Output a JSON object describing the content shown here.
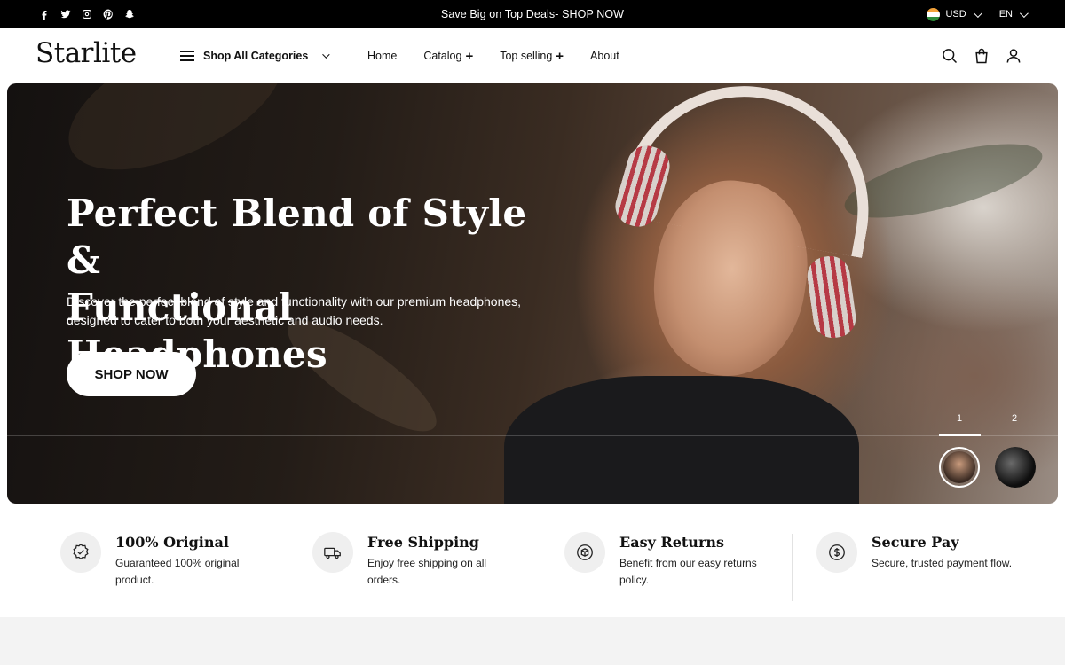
{
  "topbar": {
    "social_icons": [
      "facebook-icon",
      "twitter-icon",
      "instagram-icon",
      "pinterest-icon",
      "snapchat-icon"
    ],
    "announcement": "Save Big on Top Deals- SHOP NOW",
    "currency": "USD",
    "language": "EN"
  },
  "header": {
    "logo": "Starlite",
    "categories_label": "Shop All Categories",
    "nav": [
      {
        "label": "Home",
        "plus": ""
      },
      {
        "label": "Catalog",
        "plus": "+"
      },
      {
        "label": "Top selling",
        "plus": "+"
      },
      {
        "label": "About",
        "plus": ""
      }
    ],
    "icons": [
      "search-icon",
      "cart-bag-icon",
      "account-icon"
    ]
  },
  "hero": {
    "title_line1": "Perfect Blend of Style &",
    "title_line2": "Functional Headphones",
    "description": "Discover the perfect blend of style and functionality with our premium headphones, designed to cater to both your aesthetic and audio needs.",
    "cta": "SHOP NOW",
    "slides": [
      "1",
      "2"
    ],
    "active_slide": 1
  },
  "features": [
    {
      "title": "100% Original",
      "text": "Guaranteed 100% original product.",
      "icon": "badge-check-icon"
    },
    {
      "title": "Free Shipping",
      "text": "Enjoy free shipping on all orders.",
      "icon": "truck-icon"
    },
    {
      "title": "Easy Returns",
      "text": "Benefit from our easy returns policy.",
      "icon": "returns-box-icon"
    },
    {
      "title": "Secure Pay",
      "text": "Secure, trusted payment flow.",
      "icon": "secure-payment-icon"
    }
  ],
  "colors": {
    "topbar_bg": "#000000",
    "accent": "#111111",
    "feature_icon_bg": "#efefef",
    "footer_band": "#f3f3f3"
  }
}
